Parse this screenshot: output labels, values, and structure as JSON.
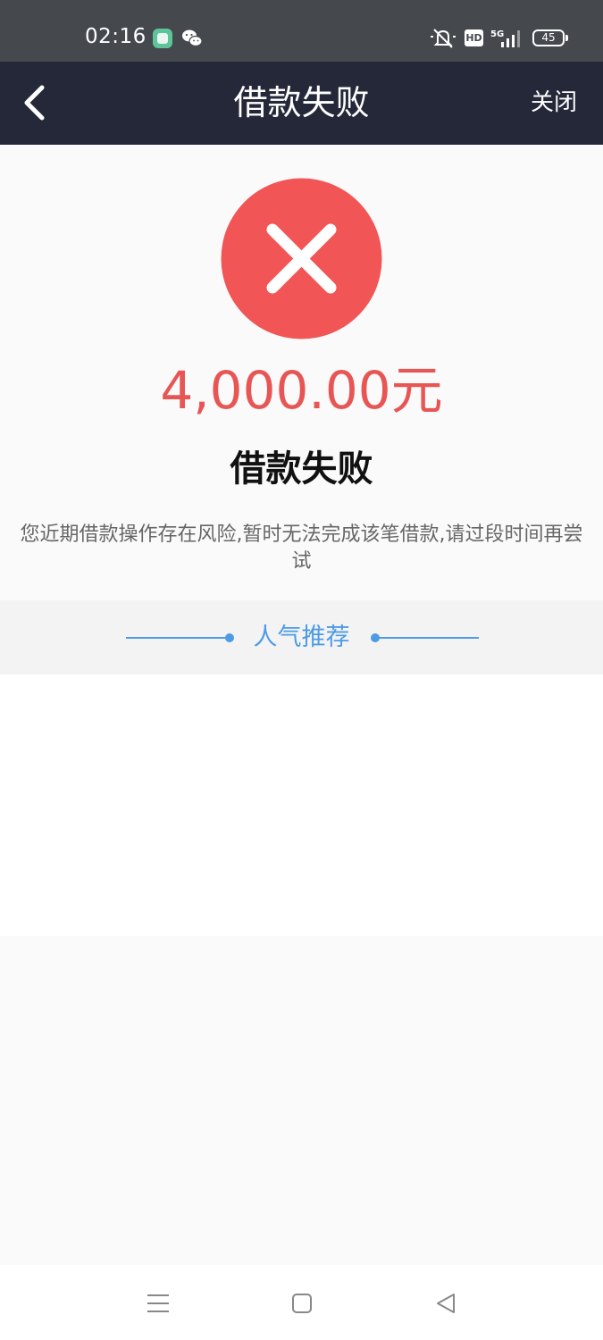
{
  "status_bar": {
    "time": "02:16",
    "hd_label": "HD",
    "network": "5G",
    "battery": "45"
  },
  "nav": {
    "title": "借款失败",
    "close_label": "关闭"
  },
  "result": {
    "amount": "4,000.00元",
    "title": "借款失败",
    "description": "您近期借款操作存在风险,暂时无法完成该笔借款,请过段时间再尝试"
  },
  "recommend": {
    "label": "人气推荐"
  },
  "colors": {
    "status_bar_bg": "#45494e",
    "nav_bg": "#242838",
    "fail_red": "#f25555",
    "amount_red": "#e85555",
    "accent_blue": "#4d9be6"
  }
}
